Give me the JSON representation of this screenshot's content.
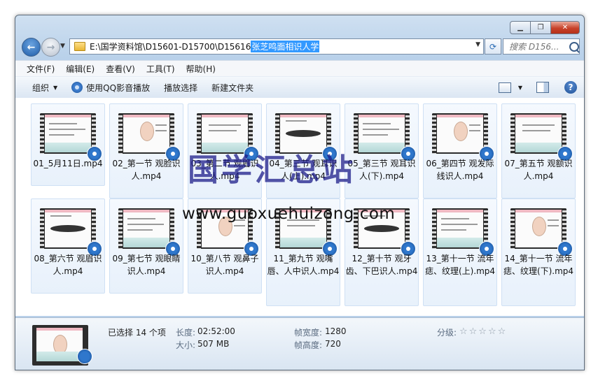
{
  "window": {
    "controls": {
      "minimize": "▁",
      "maximize": "❐",
      "close": "✕"
    },
    "colors": {
      "close": "#c8422a",
      "selection": "#3399ff",
      "accent": "#1f5da8"
    }
  },
  "address": {
    "path": "E:\\国学资料馆\\D15601-D15700\\D15616 ",
    "selected": "张芝鸣面相识人学"
  },
  "search": {
    "placeholder": "搜索 D156..."
  },
  "nav": {
    "back": "←",
    "forward": "→",
    "refresh": "⟳"
  },
  "menu": [
    "文件(F)",
    "编辑(E)",
    "查看(V)",
    "工具(T)",
    "帮助(H)"
  ],
  "toolbar": {
    "organize": "组织",
    "play_qq": "使用QQ影音播放",
    "play_selection": "播放选择",
    "new_folder": "新建文件夹",
    "help": "?"
  },
  "files": [
    {
      "name": "01_5月11日.mp4"
    },
    {
      "name": "02_第一节 观脸识人.mp4"
    },
    {
      "name": "03_第二节 观眉识人.mp4"
    },
    {
      "name": "04_第三节 观耳识人(上).mp4"
    },
    {
      "name": "05_第三节 观耳识人(下).mp4"
    },
    {
      "name": "06_第四节 观发际线识人.mp4"
    },
    {
      "name": "07_第五节 观额识人.mp4"
    },
    {
      "name": "08_第六节 观眉识人.mp4"
    },
    {
      "name": "09_第七节 观眼睛识人.mp4"
    },
    {
      "name": "10_第八节 观鼻子识人.mp4"
    },
    {
      "name": "11_第九节 观嘴唇、人中识人.mp4"
    },
    {
      "name": "12_第十节 观牙齿、下巴识人.mp4"
    },
    {
      "name": "13_第十一节 流年痣、纹理(上).mp4"
    },
    {
      "name": "14_第十一节 流年痣、纹理(下).mp4"
    }
  ],
  "watermark": {
    "text": "国学汇总站",
    "url": "www.guoxuehuizong.com"
  },
  "details": {
    "selected": "已选择 14 个项",
    "length_label": "长度:",
    "length": "02:52:00",
    "size_label": "大小:",
    "size": "507 MB",
    "width_label": "帧宽度:",
    "width": "1280",
    "height_label": "帧高度:",
    "height": "720",
    "rating_label": "分级:",
    "rating_value": 0,
    "rating_stars": "☆☆☆☆☆"
  }
}
